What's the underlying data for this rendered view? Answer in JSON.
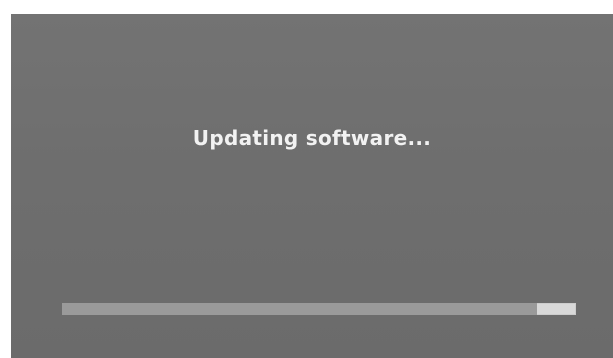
{
  "screen": {
    "title": "Updating software..."
  },
  "progress": {
    "value": 0.925
  },
  "colors": {
    "background": "#6f6f6f",
    "text": "#f2f2f2",
    "track": "#d9d9d9",
    "fill": "#9a9a9a"
  }
}
